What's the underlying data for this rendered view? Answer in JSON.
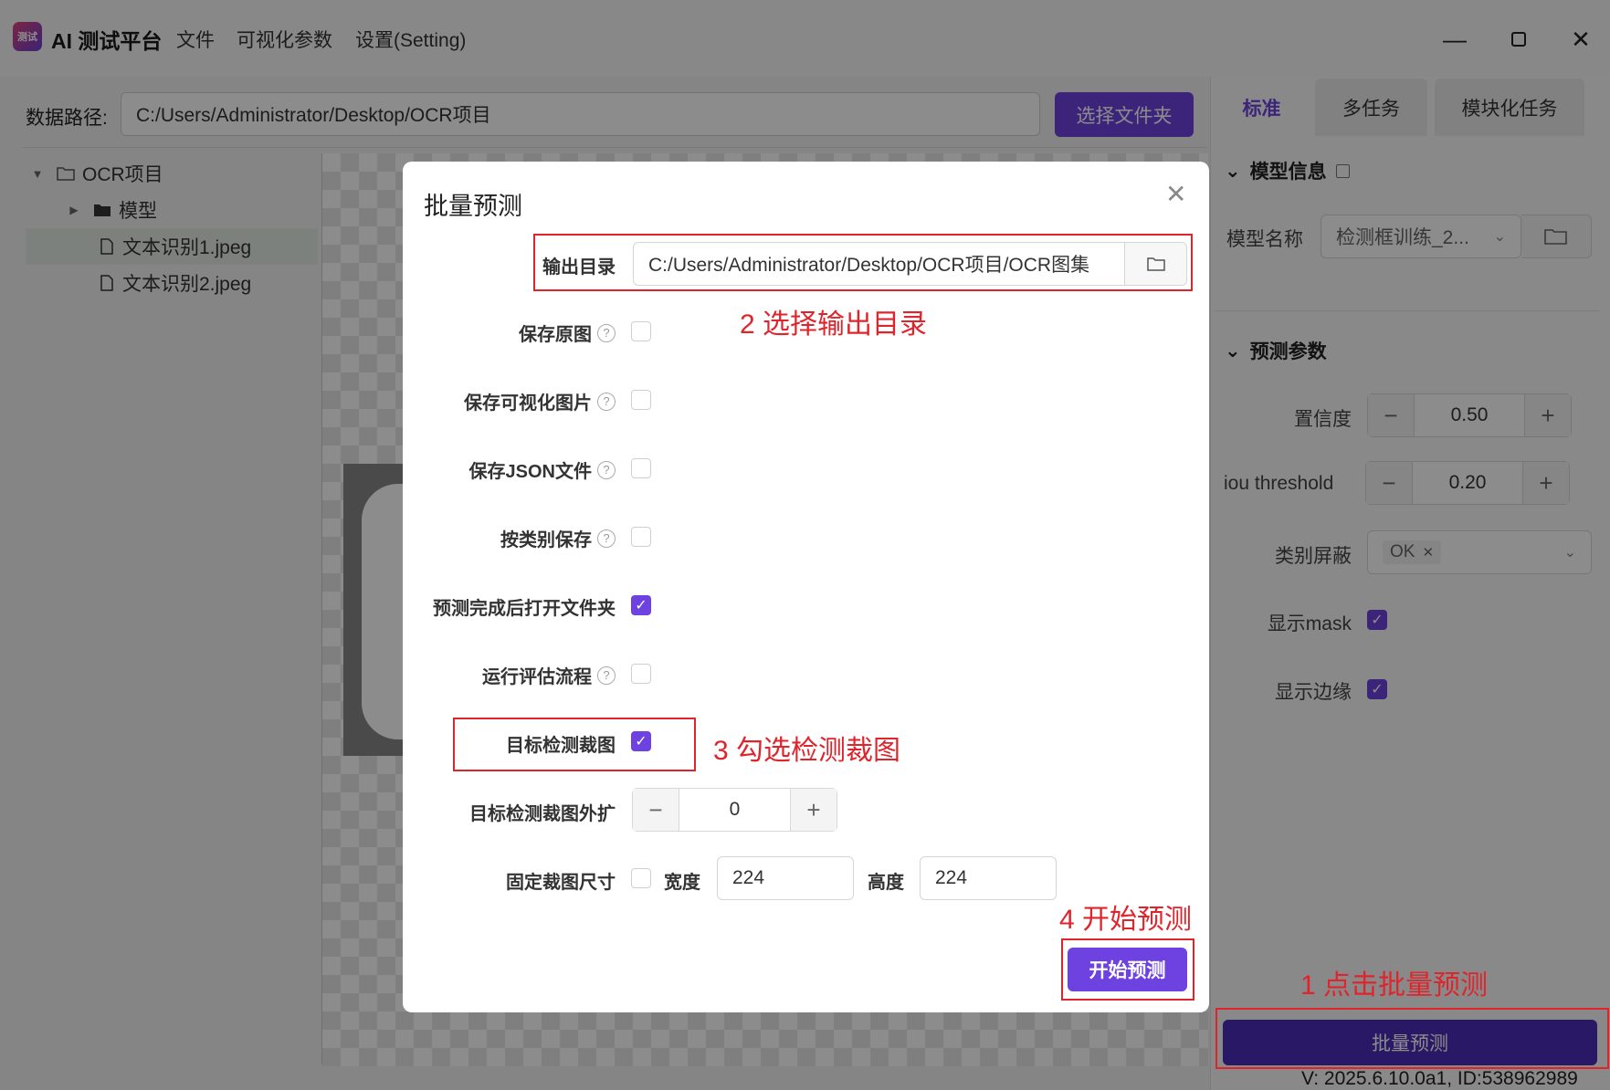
{
  "app": {
    "logo_text": "测试",
    "title": "AI 测试平台",
    "menu": [
      "文件",
      "可视化参数",
      "设置(Setting)"
    ]
  },
  "path_row": {
    "label": "数据路径:",
    "value": "C:/Users/Administrator/Desktop/OCR项目",
    "button": "选择文件夹"
  },
  "tree": {
    "root": "OCR项目",
    "folder": "模型",
    "files": [
      "文本识别1.jpeg",
      "文本识别2.jpeg"
    ]
  },
  "right_panel": {
    "tabs": [
      "标准",
      "多任务",
      "模块化任务"
    ],
    "model_section": "模型信息",
    "model_name_label": "模型名称",
    "model_name_value": "检测框训练_2...",
    "predict_section": "预测参数",
    "confidence_label": "置信度",
    "confidence_value": "0.50",
    "iou_label": "iou threshold",
    "iou_value": "0.20",
    "mask_class_label": "类别屏蔽",
    "mask_class_tag": "OK",
    "show_mask_label": "显示mask",
    "show_mask": true,
    "show_edge_label": "显示边缘",
    "show_edge": true,
    "batch_button": "批量预测",
    "version": "V: 2025.6.10.0a1, ID:538962989"
  },
  "modal": {
    "title": "批量预测",
    "output_dir_label": "输出目录",
    "output_dir_value": "C:/Users/Administrator/Desktop/OCR项目/OCR图集",
    "options": [
      {
        "label": "保存原图",
        "help": true,
        "checked": false
      },
      {
        "label": "保存可视化图片",
        "help": true,
        "checked": false
      },
      {
        "label": "保存JSON文件",
        "help": true,
        "checked": false
      },
      {
        "label": "按类别保存",
        "help": true,
        "checked": false
      },
      {
        "label": "预测完成后打开文件夹",
        "help": false,
        "checked": true
      },
      {
        "label": "运行评估流程",
        "help": true,
        "checked": false
      },
      {
        "label": "目标检测裁图",
        "help": false,
        "checked": true
      }
    ],
    "expand_label": "目标检测裁图外扩",
    "expand_value": "0",
    "fixed_size_label": "固定裁图尺寸",
    "fixed_size_checked": false,
    "width_label": "宽度",
    "width_value": "224",
    "height_label": "高度",
    "height_value": "224",
    "start_button": "开始预测"
  },
  "annotations": {
    "step1": "1 点击批量预测",
    "step2": "2 选择输出目录",
    "step3": "3 勾选检测裁图",
    "step4": "4 开始预测",
    "color": "#e0242c"
  },
  "colors": {
    "accent": "#6d42e0",
    "batch_button": "#4a2db8"
  }
}
